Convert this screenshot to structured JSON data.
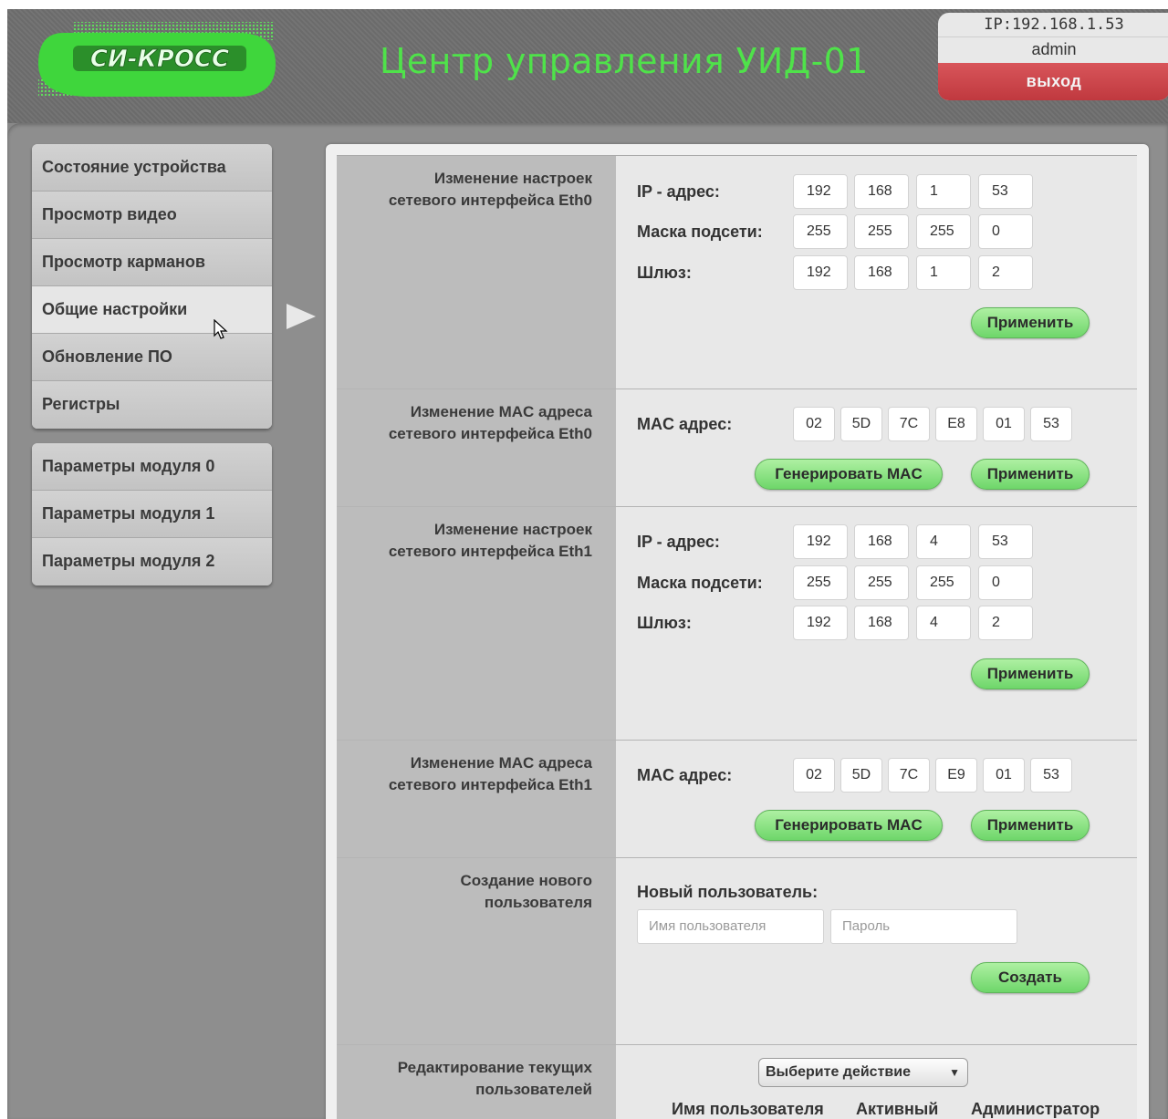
{
  "header": {
    "logo_text": "СИ-КРОСС",
    "title": "Центр управления УИД-01",
    "ip": "IP:192.168.1.53",
    "user": "admin",
    "logout_label": "выход"
  },
  "sidebar": {
    "group1": [
      {
        "label": "Состояние устройства"
      },
      {
        "label": "Просмотр видео"
      },
      {
        "label": "Просмотр карманов"
      },
      {
        "label": "Общие настройки"
      },
      {
        "label": "Обновление ПО"
      },
      {
        "label": "Регистры"
      }
    ],
    "group2": [
      {
        "label": "Параметры модуля 0"
      },
      {
        "label": "Параметры модуля 1"
      },
      {
        "label": "Параметры модуля 2"
      }
    ],
    "active_index": 3
  },
  "sections": {
    "eth0_net": {
      "title_line1": "Изменение настроек",
      "title_line2": "сетевого интерфейса Eth0",
      "ip_label": "IP - адрес:",
      "mask_label": "Маска подсети:",
      "gw_label": "Шлюз:",
      "ip": [
        "192",
        "168",
        "1",
        "53"
      ],
      "mask": [
        "255",
        "255",
        "255",
        "0"
      ],
      "gw": [
        "192",
        "168",
        "1",
        "2"
      ],
      "apply_label": "Применить"
    },
    "eth0_mac": {
      "title_line1": "Изменение MAC адреса",
      "title_line2": "сетевого интерфейса Eth0",
      "mac_label": "MAC адрес:",
      "mac": [
        "02",
        "5D",
        "7C",
        "E8",
        "01",
        "53"
      ],
      "generate_label": "Генерировать MAC",
      "apply_label": "Применить"
    },
    "eth1_net": {
      "title_line1": "Изменение настроек",
      "title_line2": "сетевого интерфейса Eth1",
      "ip_label": "IP - адрес:",
      "mask_label": "Маска подсети:",
      "gw_label": "Шлюз:",
      "ip": [
        "192",
        "168",
        "4",
        "53"
      ],
      "mask": [
        "255",
        "255",
        "255",
        "0"
      ],
      "gw": [
        "192",
        "168",
        "4",
        "2"
      ],
      "apply_label": "Применить"
    },
    "eth1_mac": {
      "title_line1": "Изменение MAC адреса",
      "title_line2": "сетевого интерфейса Eth1",
      "mac_label": "MAC адрес:",
      "mac": [
        "02",
        "5D",
        "7C",
        "E9",
        "01",
        "53"
      ],
      "generate_label": "Генерировать MAC",
      "apply_label": "Применить"
    },
    "new_user": {
      "title_line1": "Создание нового",
      "title_line2": "пользователя",
      "field_label": "Новый пользователь:",
      "username_placeholder": "Имя пользователя",
      "password_placeholder": "Пароль",
      "create_label": "Создать"
    },
    "edit_users": {
      "title_line1": "Редактирование текущих",
      "title_line2": "пользователей",
      "select_value": "Выберите действие",
      "col_username": "Имя пользователя",
      "col_active": "Активный",
      "col_admin": "Администратор"
    }
  },
  "colors": {
    "accent_green": "#4fe24a",
    "logout_red": "#c9454a",
    "button_green": "#8fe585"
  }
}
